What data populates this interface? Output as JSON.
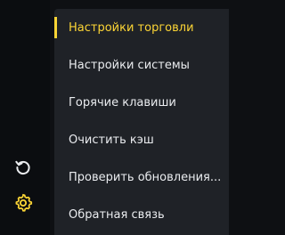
{
  "colors": {
    "accent": "#fcd535",
    "menu_bg": "#1f2227",
    "rail_bg": "#0b0d10",
    "text": "#eaecef"
  },
  "rail": {
    "icons": [
      "history-icon",
      "gear-icon"
    ]
  },
  "menu": {
    "active_index": 0,
    "items": [
      {
        "label": "Настройки торговли"
      },
      {
        "label": "Настройки системы"
      },
      {
        "label": "Горячие клавиши"
      },
      {
        "label": "Очистить кэш"
      },
      {
        "label": "Проверить обновления..."
      },
      {
        "label": "Обратная связь"
      }
    ]
  }
}
